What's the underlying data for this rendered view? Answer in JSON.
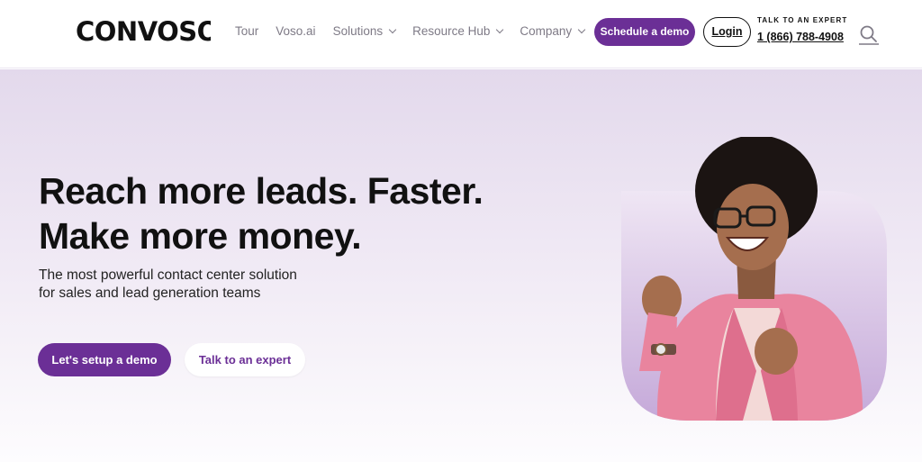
{
  "brand": {
    "logo_text": "CONVOSO",
    "accent": "#6b2f96"
  },
  "nav": {
    "items": [
      {
        "label": "Tour",
        "has_dropdown": false
      },
      {
        "label": "Voso.ai",
        "has_dropdown": false
      },
      {
        "label": "Solutions",
        "has_dropdown": true
      },
      {
        "label": "Resource Hub",
        "has_dropdown": true
      },
      {
        "label": "Company",
        "has_dropdown": true
      }
    ]
  },
  "header": {
    "schedule_label": "Schedule a demo",
    "login_label": "Login",
    "expert_label": "TALK TO AN EXPERT",
    "phone": "1 (866) 788-4908",
    "search_icon": "search-icon"
  },
  "hero": {
    "headline_line1": "Reach more leads. Faster.",
    "headline_line2": "Make more money.",
    "subhead_line1": "The most powerful contact center solution",
    "subhead_line2": "for sales and lead generation teams",
    "primary_cta": "Let's setup a demo",
    "secondary_cta": "Talk to an expert",
    "image": "excited-woman-photo"
  }
}
